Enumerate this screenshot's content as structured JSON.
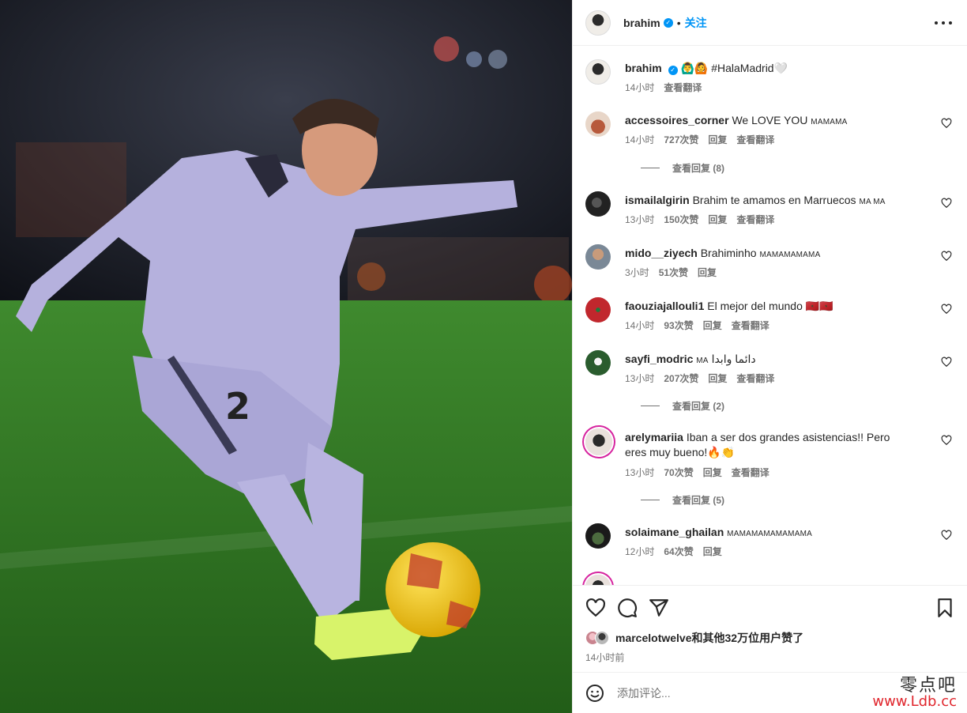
{
  "header": {
    "username": "brahim",
    "separator": "•",
    "follow_label": "关注"
  },
  "caption": {
    "username": "brahim",
    "text": "🙆‍♂️🙆 #HalaMadrid🤍",
    "time": "14小时",
    "translate": "查看翻译"
  },
  "comments": [
    {
      "username": "accessoires_corner",
      "text": "We LOVE YOU",
      "suffix": "MAMAMA",
      "time": "14小时",
      "likes": "727次赞",
      "reply": "回复",
      "translate": "查看翻译",
      "replies": "查看回复 (8)"
    },
    {
      "username": "ismailalgirin",
      "text": "Brahim te amamos en Marruecos",
      "suffix": "MA MA",
      "time": "13小时",
      "likes": "150次赞",
      "reply": "回复",
      "translate": "查看翻译",
      "replies": ""
    },
    {
      "username": "mido__ziyech",
      "text": "Brahiminho",
      "suffix": "MAMAMAMAMA",
      "time": "3小时",
      "likes": "51次赞",
      "reply": "回复",
      "translate": "",
      "replies": ""
    },
    {
      "username": "faouziajallouli1",
      "text": "El mejor del mundo 🇲🇦🇲🇦",
      "suffix": "",
      "time": "14小时",
      "likes": "93次赞",
      "reply": "回复",
      "translate": "查看翻译",
      "replies": ""
    },
    {
      "username": "sayfi_modric",
      "text": "دائما وابدا",
      "suffix": "MA",
      "time": "13小时",
      "likes": "207次赞",
      "reply": "回复",
      "translate": "查看翻译",
      "replies": "查看回复 (2)"
    },
    {
      "username": "arelymariia",
      "text": "Iban a ser dos grandes asistencias!! Pero eres muy bueno!🔥👏",
      "suffix": "",
      "time": "13小时",
      "likes": "70次赞",
      "reply": "回复",
      "translate": "查看翻译",
      "replies": "查看回复 (5)"
    },
    {
      "username": "solaimane_ghailan",
      "text": "",
      "suffix": "MAMAMAMAMAMAMA",
      "time": "12小时",
      "likes": "64次赞",
      "reply": "回复",
      "translate": "",
      "replies": ""
    }
  ],
  "likes": {
    "user": "marcelotwelve",
    "rest": "和其他32万位用户赞了"
  },
  "post_time": "14小时前",
  "comment_input": {
    "placeholder": "添加评论..."
  },
  "watermark": {
    "cn": "零点吧",
    "url": "www.Ldb.cc"
  },
  "colors": {
    "link": "#0095f6",
    "muted": "#737373",
    "text": "#262626",
    "border": "#efefef"
  },
  "icons": [
    "heart-icon",
    "comment-icon",
    "share-icon",
    "bookmark-icon",
    "emoji-icon",
    "more-icon",
    "verified-icon"
  ]
}
